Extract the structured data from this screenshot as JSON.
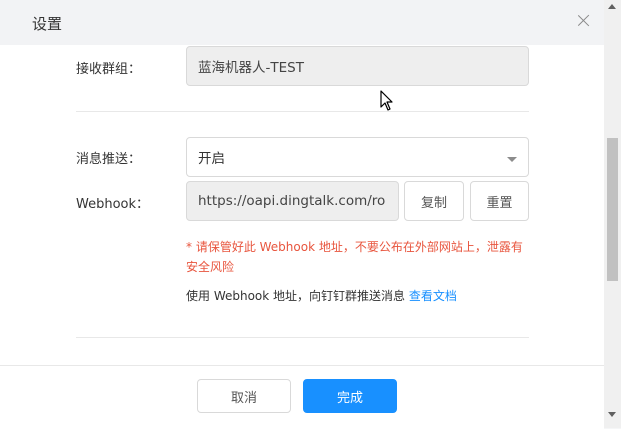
{
  "dialog": {
    "title": "设置"
  },
  "form": {
    "group_label": "接收群组：",
    "group_value": "蓝海机器人-TEST",
    "push_label": "消息推送：",
    "push_value": "开启",
    "webhook_label": "Webhook：",
    "webhook_value": "https://oapi.dingtalk.com/ro",
    "copy_label": "复制",
    "reset_label": "重置",
    "warning_text": "* 请保管好此 Webhook 地址，不要公布在外部网站上，泄露有安全风险",
    "hint_text": "使用 Webhook 地址，向钉钉群推送消息 ",
    "hint_link": "查看文档"
  },
  "footer": {
    "cancel_label": "取消",
    "done_label": "完成"
  },
  "colors": {
    "primary": "#1890ff",
    "warning": "#e8553e"
  }
}
